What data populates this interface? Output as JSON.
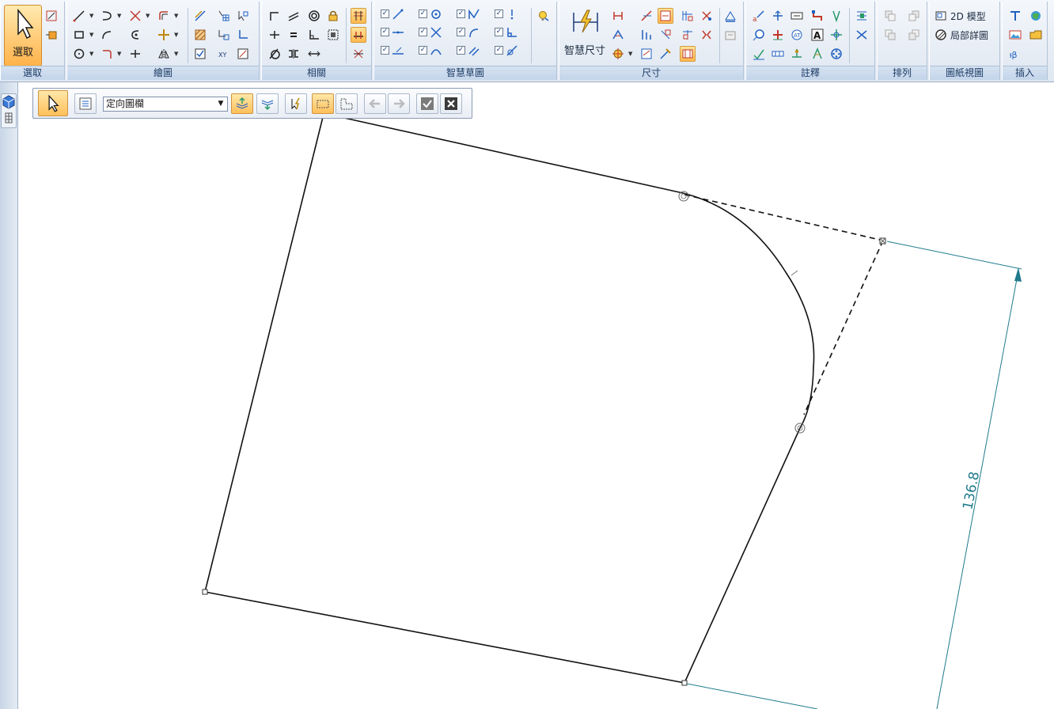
{
  "ribbon": {
    "groups": {
      "select": "選取",
      "draw": "繪圖",
      "relate": "相關",
      "intellisketch": "智慧草圖",
      "dimension": "尺寸",
      "annotation": "註釋",
      "arrange": "排列",
      "drawing_views": "圖紙視圖",
      "insert": "插入"
    },
    "buttons": {
      "select": "選取",
      "smart_dimension": "智慧尺寸",
      "model_2d": "2D 模型",
      "detail_view": "局部詳圖"
    }
  },
  "command_bar": {
    "orientation_value": "定向圖欄"
  },
  "canvas": {
    "dimension_value": "136.8"
  },
  "colors": {
    "sketch_line": "#111111",
    "dimension_line": "#1f7a8c",
    "active_button": "#ffb94f",
    "ribbon_label": "#1c3c64"
  },
  "icons": [
    "select-arrow-icon",
    "line-icon",
    "arc-icon",
    "circle-icon",
    "rectangle-icon",
    "trim-icon",
    "fill-icon",
    "smart-dimension-icon",
    "check-icon",
    "close-icon",
    "arrow-left-icon",
    "arrow-right-icon",
    "text-icon",
    "image-icon"
  ]
}
